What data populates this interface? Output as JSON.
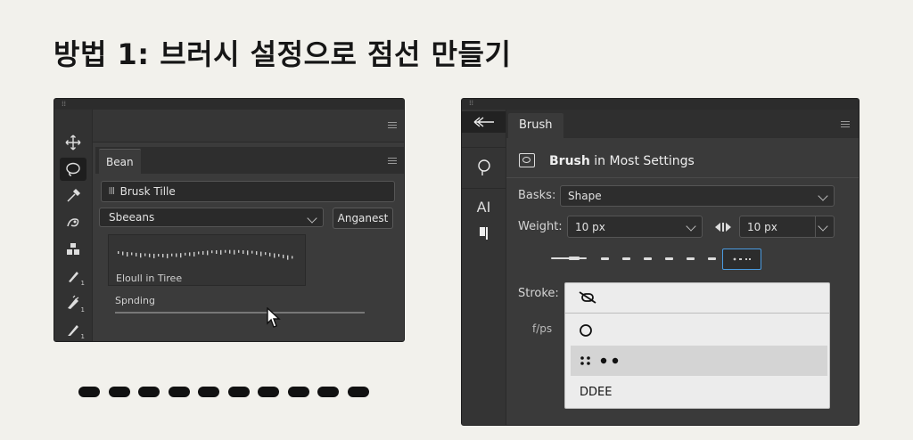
{
  "title": "방법 1: 브러시 설정으로 점선 만들기",
  "left_panel": {
    "tab_label": "Bean",
    "brush_tile_field": "Brusk Tille",
    "preset_select": "Sbeeans",
    "preset_button": "Anganest",
    "preview_caption": "Eloull  in Tiree",
    "spacing_label": "Spnding",
    "spacing_value_pct": 62,
    "tools": [
      {
        "icon": "move-icon",
        "sub": ""
      },
      {
        "icon": "lasso-icon",
        "sub": ""
      },
      {
        "icon": "eyedropper-icon",
        "sub": ""
      },
      {
        "icon": "healing-brush-icon",
        "sub": ""
      },
      {
        "icon": "stamp-icon",
        "sub": ""
      },
      {
        "icon": "brush-icon",
        "sub": "1"
      },
      {
        "icon": "mixer-brush-icon",
        "sub": "1"
      },
      {
        "icon": "pencil-icon",
        "sub": "1"
      }
    ]
  },
  "right_panel": {
    "tab_label": "Brush",
    "heading_bold": "Brush",
    "heading_rest": " in Most Settings",
    "basks_label": "Basks:",
    "basks_value": "Shape",
    "weight_label": "Weight:",
    "weight_value": "10 px",
    "weight_value_2": "10 px",
    "stroke_label": "Stroke:",
    "fps_label": "f/ps",
    "toolbar_text": "AI",
    "dropdown_items": [
      "",
      "",
      "",
      "DDEE"
    ]
  }
}
